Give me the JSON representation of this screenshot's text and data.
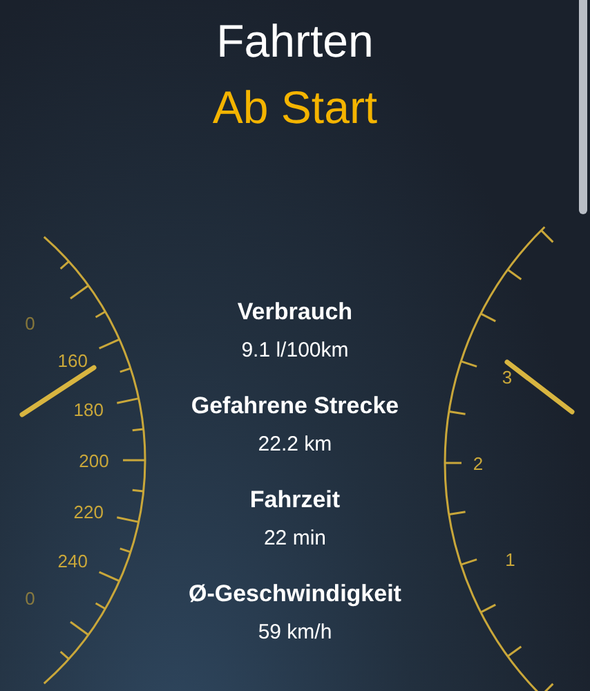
{
  "header": {
    "title": "Fahrten",
    "subtitle": "Ab Start"
  },
  "stats": [
    {
      "label": "Verbrauch",
      "value": "9.1 l/100km"
    },
    {
      "label": "Gefahrene Strecke",
      "value": "22.2 km"
    },
    {
      "label": "Fahrzeit",
      "value": "22 min"
    },
    {
      "label": "Ø-Geschwindigkeit",
      "value": "59 km/h"
    }
  ],
  "gauges": {
    "left": {
      "labels": [
        "0",
        "160",
        "180",
        "200",
        "220",
        "240",
        "0"
      ]
    },
    "right": {
      "labels": [
        "3",
        "2",
        "1"
      ]
    }
  }
}
